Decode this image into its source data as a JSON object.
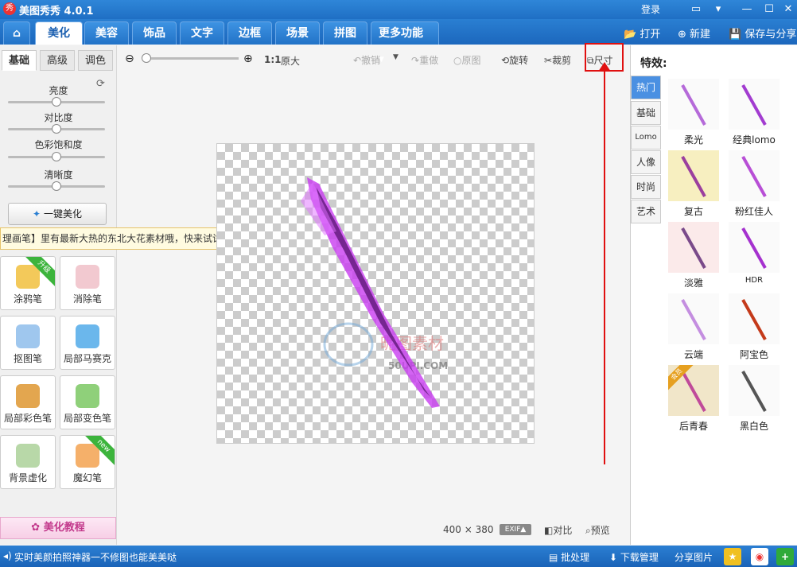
{
  "app": {
    "title": "美图秀秀 4.0.1",
    "logo_text": "秀",
    "login": "登录"
  },
  "nav": {
    "tabs": [
      "美化",
      "美容",
      "饰品",
      "文字",
      "边框",
      "场景",
      "拼图",
      "更多功能"
    ],
    "open": "打开",
    "new": "新建",
    "save": "保存与分享"
  },
  "toolbar": {
    "zoom_ratio": "1:1",
    "original_size": "原大",
    "undo": "撤销",
    "redo": "重做",
    "original_image": "原图",
    "rotate": "旋转",
    "crop": "裁剪",
    "resize": "尺寸"
  },
  "left": {
    "subtabs": [
      "基础",
      "高级",
      "调色"
    ],
    "sliders": [
      {
        "label": "亮度",
        "value": 0.5
      },
      {
        "label": "对比度",
        "value": 0.5
      },
      {
        "label": "色彩饱和度",
        "value": 0.5
      },
      {
        "label": "清晰度",
        "value": 0.5
      }
    ],
    "one_key": "一键美化",
    "tooltip": "理画笔】里有最新大热的东北大花素材哦，快来试试!",
    "tools": [
      {
        "label": "涂鸦笔",
        "badge": "升级"
      },
      {
        "label": "消除笔"
      },
      {
        "label": "抠图笔"
      },
      {
        "label": "局部马赛克"
      },
      {
        "label": "局部彩色笔"
      },
      {
        "label": "局部变色笔"
      },
      {
        "label": "背景虚化"
      },
      {
        "label": "魔幻笔",
        "badge": "new"
      }
    ],
    "tutorial": "美化教程"
  },
  "canvas": {
    "dims": "400 × 380",
    "watermark_cn": "昵图素材",
    "watermark_en": "50UPI.COM"
  },
  "bottom": {
    "exif": "EXIF▲",
    "compare": "对比",
    "preview": "预览"
  },
  "right": {
    "title": "特效:",
    "categories": [
      "热门",
      "基础",
      "Lomo",
      "人像",
      "时尚",
      "艺术"
    ],
    "effects": [
      {
        "name": "柔光"
      },
      {
        "name": "经典lomo"
      },
      {
        "name": "复古"
      },
      {
        "name": "粉红佳人"
      },
      {
        "name": "淡雅"
      },
      {
        "name": "HDR"
      },
      {
        "name": "云端"
      },
      {
        "name": "阿宝色"
      },
      {
        "name": "后青春",
        "badge": "会员"
      },
      {
        "name": "黑白色"
      }
    ]
  },
  "status": {
    "tip": "实时美颜拍照神器一不修图也能美美哒",
    "batch": "批处理",
    "download": "下载管理",
    "share": "分享图片"
  },
  "colors": {
    "accent": "#1f6fc4",
    "highlight": "#e01010",
    "sword": "#c83cf0"
  }
}
